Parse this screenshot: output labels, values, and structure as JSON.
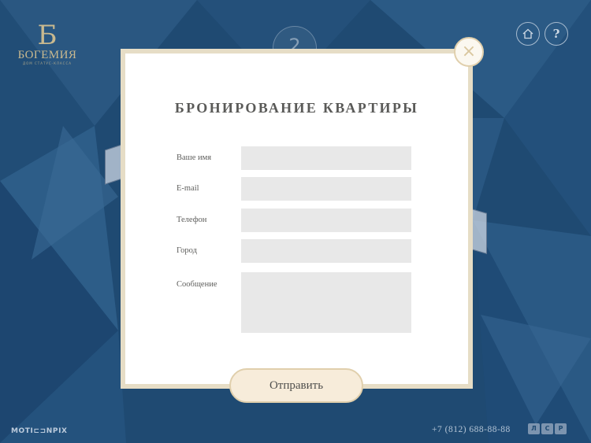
{
  "logo": {
    "mark": "Б",
    "name": "БОГЕМИЯ",
    "tagline": "ДОМ СТАТУС-КЛАССА"
  },
  "header": {
    "home_icon": "home-icon",
    "help_label": "?",
    "step_number": "2"
  },
  "modal": {
    "title": "БРОНИРОВАНИЕ КВАРТИРЫ",
    "close_label": "×",
    "fields": [
      {
        "label": "Ваше имя",
        "value": "",
        "placeholder": ""
      },
      {
        "label": "E-mail",
        "value": "",
        "placeholder": ""
      },
      {
        "label": "Телефон",
        "value": "",
        "placeholder": ""
      },
      {
        "label": "Город",
        "value": "",
        "placeholder": ""
      },
      {
        "label": "Сообщение",
        "value": "",
        "placeholder": ""
      }
    ],
    "submit_label": "Отправить"
  },
  "footer": {
    "brand": "MOTI⊏⊐NPIX",
    "phone": "+7 (812) 688-88-88",
    "developer_letters": [
      "Л",
      "С",
      "Р"
    ]
  },
  "colors": {
    "background": "#1f4a72",
    "modal_border": "#e6ddc6",
    "input_fill": "#e8e8e8",
    "button_fill": "#f7ecda",
    "accent_gold": "#c9b98f"
  }
}
